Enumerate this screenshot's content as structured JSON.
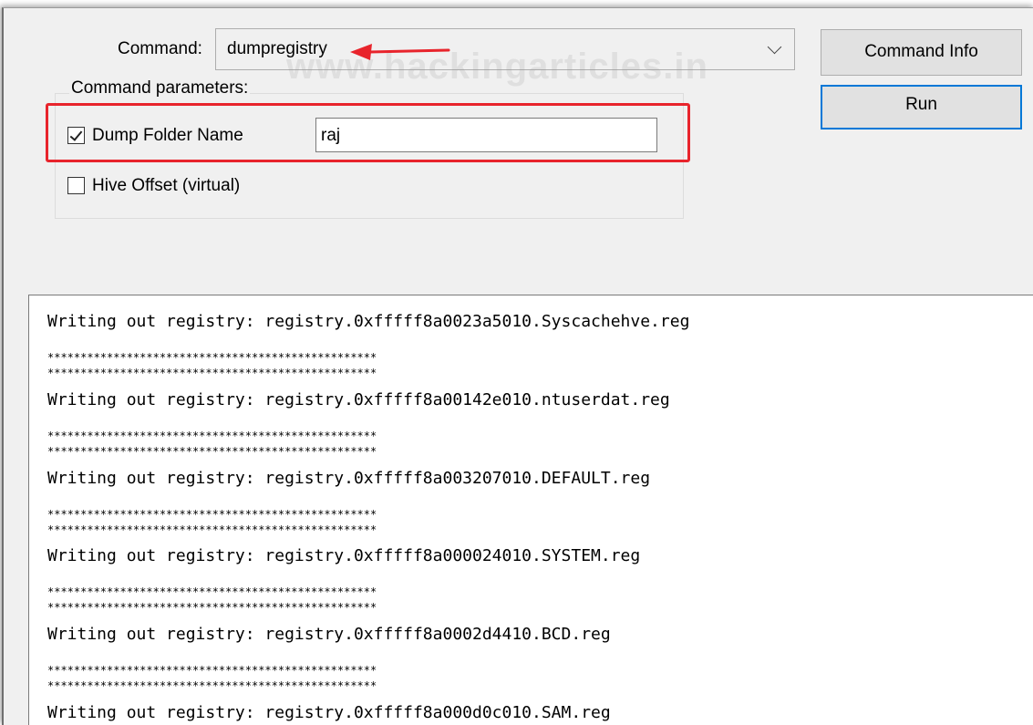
{
  "command": {
    "label": "Command:",
    "selected": "dumpregistry"
  },
  "watermark": "www.hackingarticles.in",
  "buttons": {
    "command_info": "Command Info",
    "run": "Run"
  },
  "parameters": {
    "group_title": "Command parameters:",
    "dump_folder": {
      "label": "Dump Folder Name",
      "checked": true,
      "value": "raj"
    },
    "hive_offset": {
      "label": "Hive Offset (virtual)",
      "checked": false
    }
  },
  "output": {
    "separator": "**************************************************",
    "lines": [
      "Writing out registry: registry.0xfffff8a0023a5010.Syscachehve.reg",
      "Writing out registry: registry.0xfffff8a00142e010.ntuserdat.reg",
      "Writing out registry: registry.0xfffff8a003207010.DEFAULT.reg",
      "Writing out registry: registry.0xfffff8a000024010.SYSTEM.reg",
      "Writing out registry: registry.0xfffff8a0002d4410.BCD.reg",
      "Writing out registry: registry.0xfffff8a000d0c010.SAM.reg"
    ]
  },
  "colors": {
    "annotation_red": "#e8242c",
    "focus_blue": "#0078d7"
  },
  "icons": [
    "chevron-down-icon",
    "red-arrow-annotation",
    "checkbox-checked",
    "checkbox-unchecked"
  ]
}
